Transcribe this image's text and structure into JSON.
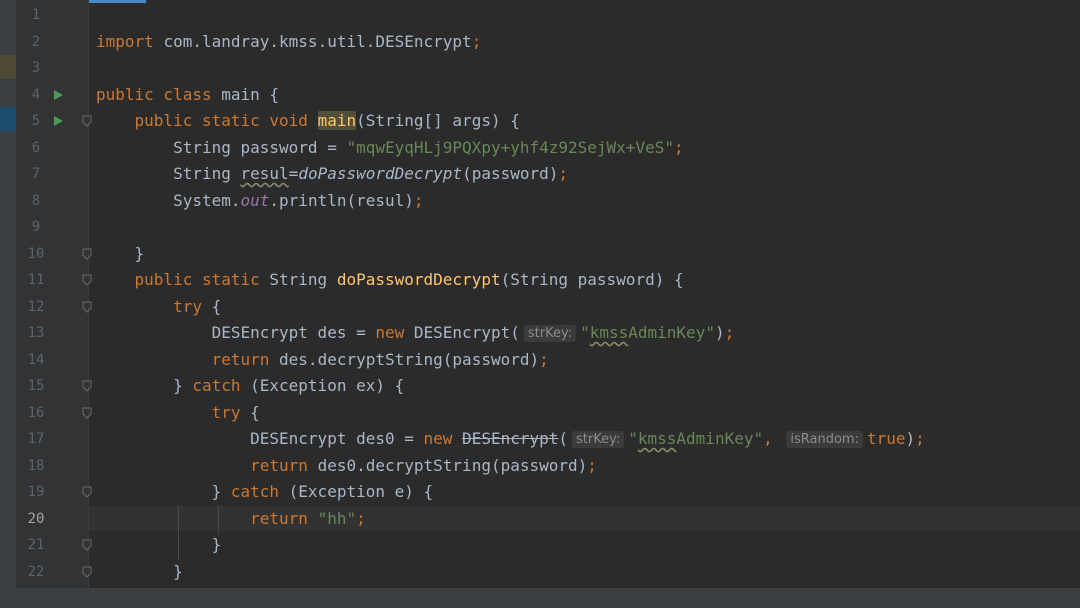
{
  "editor": {
    "lines": [
      {
        "no": "1",
        "t": []
      },
      {
        "no": "2",
        "t": [
          [
            "kw",
            "import "
          ],
          [
            "",
            "com.landray.kmss.util.DESEncrypt"
          ],
          [
            "kw",
            ";"
          ]
        ]
      },
      {
        "no": "3",
        "t": []
      },
      {
        "no": "4",
        "t": [
          [
            "kw",
            "public class "
          ],
          [
            "",
            "main {"
          ]
        ]
      },
      {
        "no": "5",
        "t": [
          [
            "",
            "    "
          ],
          [
            "kw",
            "public static void "
          ],
          [
            "fn hl",
            "main"
          ],
          [
            "",
            "(String[] args) {"
          ]
        ]
      },
      {
        "no": "6",
        "t": [
          [
            "",
            "        String password = "
          ],
          [
            "str",
            "\"mqwEyqHLj9PQXpy+yhf4z92SejWx+VeS\""
          ],
          [
            "kw",
            ";"
          ]
        ]
      },
      {
        "no": "7",
        "t": [
          [
            "",
            "        String "
          ],
          [
            "wavy",
            "resul"
          ],
          [
            "",
            "="
          ],
          [
            "it",
            "doPasswordDecrypt"
          ],
          [
            "",
            "(password)"
          ],
          [
            "kw",
            ";"
          ]
        ]
      },
      {
        "no": "8",
        "t": [
          [
            "",
            "        System."
          ],
          [
            "field",
            "out"
          ],
          [
            "",
            ".println(resul)"
          ],
          [
            "kw",
            ";"
          ]
        ]
      },
      {
        "no": "9",
        "t": []
      },
      {
        "no": "10",
        "t": [
          [
            "",
            "    }"
          ]
        ]
      },
      {
        "no": "11",
        "t": [
          [
            "",
            "    "
          ],
          [
            "kw",
            "public static "
          ],
          [
            "",
            "String "
          ],
          [
            "fn",
            "doPasswordDecrypt"
          ],
          [
            "",
            "(String password) {"
          ]
        ]
      },
      {
        "no": "12",
        "t": [
          [
            "",
            "        "
          ],
          [
            "kw",
            "try "
          ],
          [
            "",
            "{"
          ]
        ]
      },
      {
        "no": "13",
        "t": [
          [
            "",
            "            DESEncrypt des = "
          ],
          [
            "kw",
            "new "
          ],
          [
            "",
            "DESEncrypt("
          ],
          [
            "hint",
            "strKey:"
          ],
          [
            "str",
            "\""
          ],
          [
            "str wavy",
            "kmss"
          ],
          [
            "str",
            "AdminKey\""
          ],
          [
            "",
            ")"
          ],
          [
            "kw",
            ";"
          ]
        ]
      },
      {
        "no": "14",
        "t": [
          [
            "",
            "            "
          ],
          [
            "kw",
            "return "
          ],
          [
            "",
            "des.decryptString(password)"
          ],
          [
            "kw",
            ";"
          ]
        ]
      },
      {
        "no": "15",
        "t": [
          [
            "",
            "        } "
          ],
          [
            "kw",
            "catch "
          ],
          [
            "",
            "(Exception ex) {"
          ]
        ]
      },
      {
        "no": "16",
        "t": [
          [
            "",
            "            "
          ],
          [
            "kw",
            "try "
          ],
          [
            "",
            "{"
          ]
        ]
      },
      {
        "no": "17",
        "t": [
          [
            "",
            "                DESEncrypt des0 = "
          ],
          [
            "kw",
            "new "
          ],
          [
            "strike",
            "DESEncrypt"
          ],
          [
            "",
            "("
          ],
          [
            "hint",
            "strKey:"
          ],
          [
            "str",
            "\""
          ],
          [
            "str wavy",
            "kmss"
          ],
          [
            "str",
            "AdminKey\""
          ],
          [
            "kw",
            ", "
          ],
          [
            "hint",
            "isRandom:"
          ],
          [
            "kw",
            "true"
          ],
          [
            "",
            ")"
          ],
          [
            "kw",
            ";"
          ]
        ]
      },
      {
        "no": "18",
        "t": [
          [
            "",
            "                "
          ],
          [
            "kw",
            "return "
          ],
          [
            "",
            "des0.decryptString(password)"
          ],
          [
            "kw",
            ";"
          ]
        ]
      },
      {
        "no": "19",
        "t": [
          [
            "",
            "            } "
          ],
          [
            "kw",
            "catch "
          ],
          [
            "",
            "(Exception e) {"
          ]
        ]
      },
      {
        "no": "20",
        "t": [
          [
            "",
            "                "
          ],
          [
            "kw",
            "return "
          ],
          [
            "str",
            "\"hh\""
          ],
          [
            "kw",
            ";"
          ]
        ]
      },
      {
        "no": "21",
        "t": [
          [
            "",
            "            }"
          ]
        ]
      },
      {
        "no": "22",
        "t": [
          [
            "",
            "        }"
          ]
        ]
      }
    ],
    "current_line": "20",
    "run_lines": [
      "4",
      "5"
    ],
    "fold_lines": [
      "5",
      "10",
      "11",
      "12",
      "15",
      "16",
      "19",
      "21",
      "22"
    ]
  }
}
